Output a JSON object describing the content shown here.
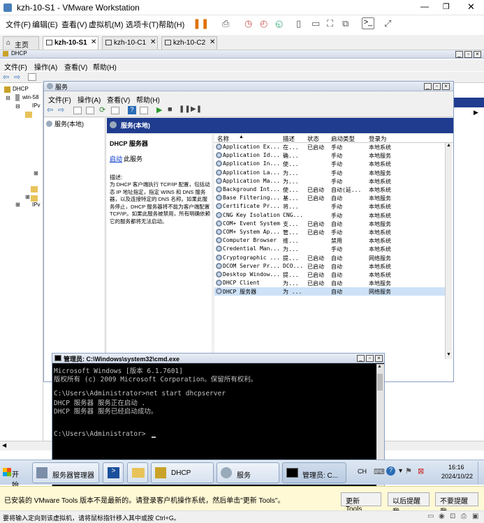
{
  "vmware": {
    "title": "kzh-10-S1 - VMware Workstation",
    "menu": [
      "文件(F)",
      "编辑(E)",
      "查看(V)",
      "虚拟机(M)",
      "选项卡(T)",
      "帮助(H)"
    ],
    "tabs": [
      {
        "label": "主页"
      },
      {
        "label": "kzh-10-S1"
      },
      {
        "label": "kzh-10-C1"
      },
      {
        "label": "kzh-10-C2"
      }
    ]
  },
  "dhcp_console": {
    "title": "DHCP",
    "menu": [
      "文件(F)",
      "操作(A)",
      "查看(V)",
      "帮助(H)"
    ],
    "tree": [
      "DHCP",
      "win-58",
      "IPv",
      "IPv"
    ]
  },
  "services_window": {
    "title": "服务",
    "menu": [
      "文件(F)",
      "操作(A)",
      "查看(V)",
      "帮助(H)"
    ],
    "tree_label": "服务(本地)",
    "header": "服务(本地)",
    "detail_title": "DHCP 服务器",
    "detail_link": "启动",
    "detail_link_suffix": "此服务",
    "description_label": "描述:",
    "description": "为 DHCP 客户端执行 TCP/IP 配置，包括动态 IP 地址指定，指定 WINS 和 DNS 服务器，以及连接特定的 DNS 名称。如果此服务停止，DHCP 服务器将不能为客户端配置 TCP/IP。如果此服务被禁用，所有明确依赖它的服务都将无法启动。",
    "columns": [
      "名称",
      "描述",
      "状态",
      "启动类型",
      "登录为"
    ],
    "rows": [
      {
        "name": "Application Ex...",
        "desc": "在...",
        "status": "已启动",
        "startup": "手动",
        "logon": "本地系统"
      },
      {
        "name": "Application Id...",
        "desc": "确...",
        "status": "",
        "startup": "手动",
        "logon": "本地服务"
      },
      {
        "name": "Application In...",
        "desc": "使...",
        "status": "",
        "startup": "手动",
        "logon": "本地系统"
      },
      {
        "name": "Application La...",
        "desc": "为...",
        "status": "",
        "startup": "手动",
        "logon": "本地服务"
      },
      {
        "name": "Application Ma...",
        "desc": "为...",
        "status": "",
        "startup": "手动",
        "logon": "本地系统"
      },
      {
        "name": "Background Int...",
        "desc": "使...",
        "status": "已启动",
        "startup": "自动(延...",
        "logon": "本地系统"
      },
      {
        "name": "Base Filtering...",
        "desc": "基...",
        "status": "已启动",
        "startup": "自动",
        "logon": "本地服务"
      },
      {
        "name": "Certificate Pr...",
        "desc": "将...",
        "status": "",
        "startup": "手动",
        "logon": "本地系统"
      },
      {
        "name": "CNG Key Isolation",
        "desc": "CNG...",
        "status": "",
        "startup": "手动",
        "logon": "本地系统"
      },
      {
        "name": "COM+ Event System",
        "desc": "支...",
        "status": "已启动",
        "startup": "自动",
        "logon": "本地服务"
      },
      {
        "name": "COM+ System Ap...",
        "desc": "管...",
        "status": "已启动",
        "startup": "手动",
        "logon": "本地系统"
      },
      {
        "name": "Computer Browser",
        "desc": "维...",
        "status": "",
        "startup": "禁用",
        "logon": "本地系统"
      },
      {
        "name": "Credential Man...",
        "desc": "为...",
        "status": "",
        "startup": "手动",
        "logon": "本地系统"
      },
      {
        "name": "Cryptographic ...",
        "desc": "提...",
        "status": "已启动",
        "startup": "自动",
        "logon": "网络服务"
      },
      {
        "name": "DCOM Server Pr...",
        "desc": "DCO...",
        "status": "已启动",
        "startup": "自动",
        "logon": "本地系统"
      },
      {
        "name": "Desktop Window...",
        "desc": "提...",
        "status": "已启动",
        "startup": "自动",
        "logon": "本地系统"
      },
      {
        "name": "DHCP Client",
        "desc": "为...",
        "status": "已启动",
        "startup": "自动",
        "logon": "本地服务"
      },
      {
        "name": "DHCP 服务器",
        "desc": "为 ...",
        "status": "",
        "startup": "自动",
        "logon": "网络服务"
      }
    ]
  },
  "cmd": {
    "title": "管理员: C:\\Windows\\system32\\cmd.exe",
    "lines": [
      "Microsoft Windows [版本 6.1.7601]",
      "版权所有 (c) 2009 Microsoft Corporation。保留所有权利。",
      "",
      "C:\\Users\\Administrator>net start dhcpserver",
      "DHCP 服务器 服务正在启动 .",
      "DHCP 服务器 服务已经启动成功。",
      "",
      "",
      "C:\\Users\\Administrator>"
    ]
  },
  "taskbar": {
    "start_label": "开始",
    "buttons": [
      "服务器管理器",
      "DHCP",
      "服务",
      "管理员: C..."
    ],
    "lang": "CH",
    "time": "16:16",
    "date": "2024/10/22"
  },
  "notification": {
    "message": "已安装的 VMware Tools 版本不是最新的。请登录客户机操作系统，然后单击\"更新 Tools\"。",
    "update_button": "更新 Tools",
    "later_button": "以后提醒我",
    "never_button": "不要提醒我"
  },
  "status_bar": {
    "text": "要将输入定向到该虚拟机，请将鼠标指针移入其中或按 Ctrl+G。"
  },
  "colors": {
    "accent": "#1f3c8f",
    "cmd_bg": "#000000",
    "cmd_text": "#c0c0c0",
    "notify_bg": "#fff9d6"
  }
}
